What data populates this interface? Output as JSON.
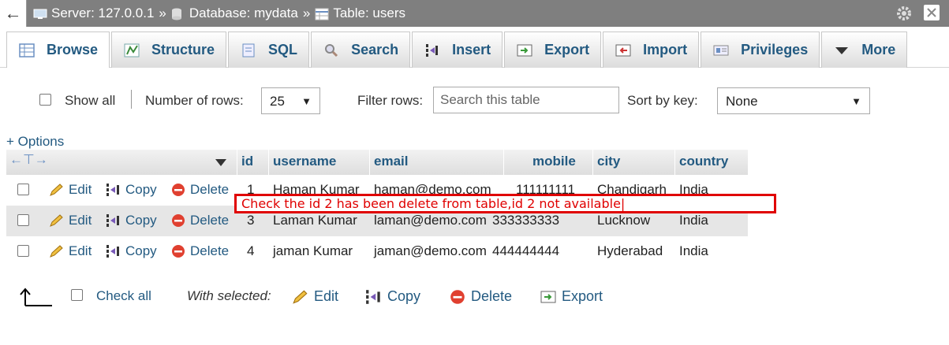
{
  "breadcrumb": {
    "server": "Server: 127.0.0.1",
    "database": "Database: mydata",
    "table": "Table: users",
    "separator": "»"
  },
  "tabs": [
    {
      "label": "Browse",
      "icon": "browse-icon"
    },
    {
      "label": "Structure",
      "icon": "structure-icon"
    },
    {
      "label": "SQL",
      "icon": "sql-icon"
    },
    {
      "label": "Search",
      "icon": "search-icon"
    },
    {
      "label": "Insert",
      "icon": "insert-icon"
    },
    {
      "label": "Export",
      "icon": "export-icon"
    },
    {
      "label": "Import",
      "icon": "import-icon"
    },
    {
      "label": "Privileges",
      "icon": "privileges-icon"
    },
    {
      "label": "More",
      "icon": "triangle-down-icon"
    }
  ],
  "filters": {
    "show_all": "Show all",
    "num_rows_label": "Number of rows:",
    "num_rows_value": "25",
    "filter_label": "Filter rows:",
    "filter_placeholder": "Search this table",
    "sort_label": "Sort by key:",
    "sort_value": "None"
  },
  "options_link": "+ Options",
  "table": {
    "headers": [
      "id",
      "username",
      "email",
      "mobile",
      "city",
      "country"
    ],
    "actions": {
      "edit": "Edit",
      "copy": "Copy",
      "delete": "Delete"
    },
    "rows": [
      {
        "id": "1",
        "username": "Haman Kumar",
        "email": "haman@demo.com",
        "mobile": "111111111",
        "city": "Chandigarh",
        "country": "India"
      },
      {
        "id": "3",
        "username": "Laman Kumar",
        "email": "laman@demo.com",
        "mobile": "333333333",
        "city": "Lucknow",
        "country": "India"
      },
      {
        "id": "4",
        "username": "jaman Kumar",
        "email": "jaman@demo.com",
        "mobile": "444444444",
        "city": "Hyderabad",
        "country": "India"
      }
    ]
  },
  "annotation": "Check the id 2 has been delete from table,id 2 not available|",
  "bottom": {
    "check_all": "Check all",
    "with_selected": "With selected:",
    "edit": "Edit",
    "copy": "Copy",
    "delete": "Delete",
    "export": "Export"
  },
  "colors": {
    "link": "#235a81",
    "annotation": "#e00000",
    "topbar": "#7f7f7f"
  }
}
